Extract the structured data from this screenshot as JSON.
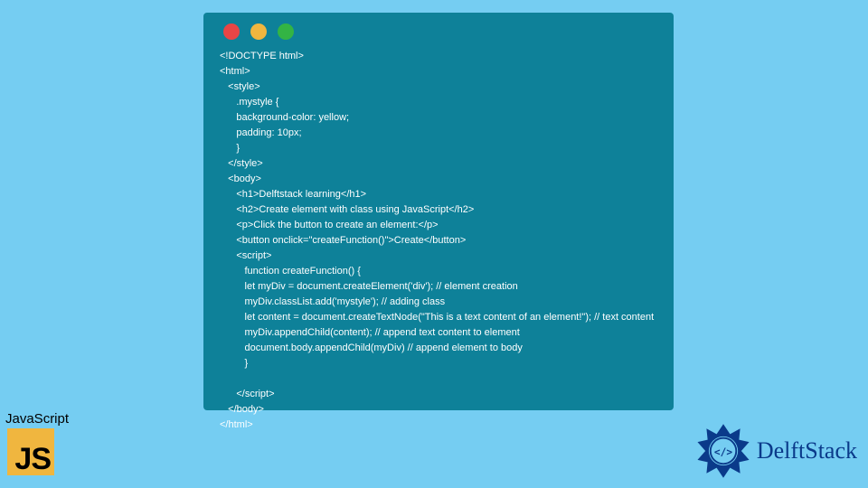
{
  "code_window": {
    "dots": [
      "red",
      "yellow",
      "green"
    ],
    "code_text": "<!DOCTYPE html>\n<html>\n   <style>\n      .mystyle {\n      background-color: yellow;\n      padding: 10px;\n      }\n   </style>\n   <body>\n      <h1>Delftstack learning</h1>\n      <h2>Create element with class using JavaScript</h2>\n      <p>Click the button to create an element:</p>\n      <button onclick=\"createFunction()\">Create</button>\n      <script>\n         function createFunction() {\n         let myDiv = document.createElement('div'); // element creation\n         myDiv.classList.add('mystyle'); // adding class\n         let content = document.createTextNode(\"This is a text content of an element!\"); // text content\n         myDiv.appendChild(content); // append text content to element\n         document.body.appendChild(myDiv) // append element to body\n         }\n         \n      </script>\n   </body>\n</html>"
  },
  "js_badge": {
    "label": "JavaScript",
    "logo_text": "JS"
  },
  "delftstack": {
    "text": "DelftStack",
    "logo_glyph": "</>"
  }
}
